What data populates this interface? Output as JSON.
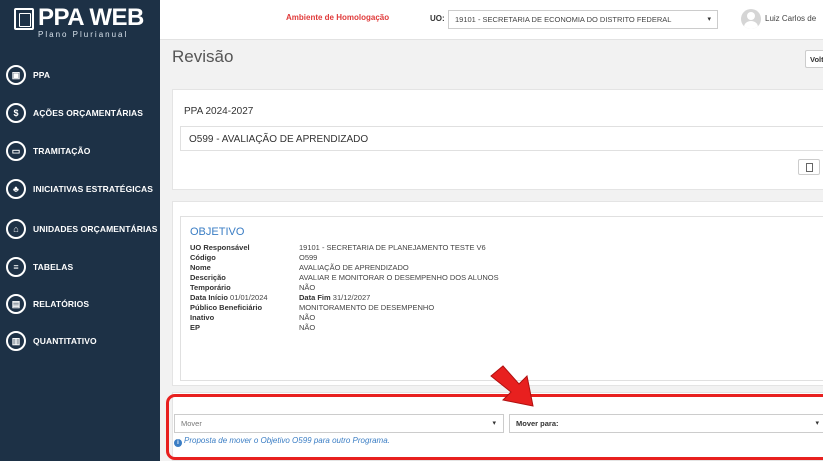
{
  "app": {
    "logo_text": "PPA WEB",
    "logo_subtitle": "Plano Plurianual"
  },
  "sidebar": {
    "items": [
      {
        "label": "PPA",
        "icon": "book-icon",
        "glyph": "▣"
      },
      {
        "label": "AÇÕES ORÇAMENTÁRIAS",
        "icon": "dollar-icon",
        "glyph": "$"
      },
      {
        "label": "TRAMITAÇÃO",
        "icon": "inbox-icon",
        "glyph": "▭"
      },
      {
        "label": "INICIATIVAS ESTRATÉGICAS",
        "icon": "sitemap-icon",
        "glyph": "♣"
      },
      {
        "label": "UNIDADES ORÇAMENTÁRIAS",
        "icon": "bank-icon",
        "glyph": "⌂"
      },
      {
        "label": "TABELAS",
        "icon": "list-icon",
        "glyph": "≡"
      },
      {
        "label": "RELATÓRIOS",
        "icon": "file-icon",
        "glyph": "▤"
      },
      {
        "label": "QUANTITATIVO",
        "icon": "chart-icon",
        "glyph": "▥"
      }
    ]
  },
  "topbar": {
    "environment": "Ambiente de Homologação",
    "uo_label": "UO:",
    "uo_value": "19101 - SECRETARIA DE ECONOMIA DO DISTRITO FEDERAL",
    "user_name": "Luiz Carlos de"
  },
  "page": {
    "title": "Revisão",
    "back_label": "Volt"
  },
  "program": {
    "ppa": "PPA 2024-2027",
    "name": "O599 - AVALIAÇÃO DE APRENDIZADO"
  },
  "objetivo": {
    "heading": "OBJETIVO",
    "fields": [
      {
        "label": "UO Responsável",
        "value": "19101 - SECRETARIA DE PLANEJAMENTO TESTE V6"
      },
      {
        "label": "Código",
        "value": "O599"
      },
      {
        "label": "Nome",
        "value": "AVALIAÇÃO DE APRENDIZADO"
      },
      {
        "label": "Descrição",
        "value": "AVALIAR E MONITORAR O DESEMPENHO DOS ALUNOS"
      },
      {
        "label": "Temporário",
        "value": "NÃO"
      },
      {
        "label": "Data Início",
        "label_value": "01/01/2024",
        "value_label": "Data Fim",
        "value": "31/12/2027"
      },
      {
        "label": "Público Beneficiário",
        "value": "MONITORAMENTO DE DESEMPENHO"
      },
      {
        "label": "Inativo",
        "value": "NÃO"
      },
      {
        "label": "EP",
        "value": "NÃO"
      }
    ]
  },
  "action": {
    "mover_value": "Mover",
    "mover_para_label": "Mover para:",
    "hint": "Proposta de mover o Objetivo O599 para outro Programa."
  },
  "colors": {
    "sidebar_bg": "#1d3146",
    "accent_blue": "#3a7dc4",
    "highlight_red": "#e8201f"
  }
}
